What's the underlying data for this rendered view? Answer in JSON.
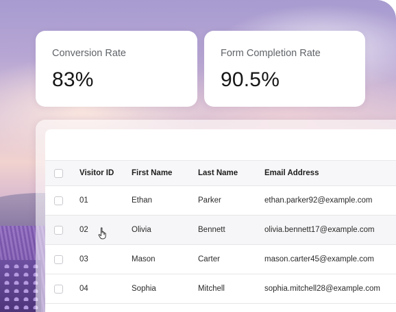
{
  "stats": [
    {
      "label": "Conversion Rate",
      "value": "83%"
    },
    {
      "label": "Form Completion Rate",
      "value": "90.5%"
    }
  ],
  "table": {
    "headers": {
      "visitor_id": "Visitor ID",
      "first_name": "First Name",
      "last_name": "Last Name",
      "email": "Email Address"
    },
    "rows": [
      {
        "visitor_id": "01",
        "first_name": "Ethan",
        "last_name": "Parker",
        "email": "ethan.parker92@example.com"
      },
      {
        "visitor_id": "02",
        "first_name": "Olivia",
        "last_name": "Bennett",
        "email": "olivia.bennett17@example.com"
      },
      {
        "visitor_id": "03",
        "first_name": "Mason",
        "last_name": "Carter",
        "email": "mason.carter45@example.com"
      },
      {
        "visitor_id": "04",
        "first_name": "Sophia",
        "last_name": "Mitchell",
        "email": "sophia.mitchell28@example.com"
      }
    ]
  },
  "icons": {
    "cursor": "hand-pointer-icon",
    "checkbox": "checkbox-icon"
  },
  "colors": {
    "card_bg": "#ffffff",
    "text_primary": "#161616",
    "text_secondary": "#5f6368",
    "row_alt": "#f6f6f8"
  }
}
